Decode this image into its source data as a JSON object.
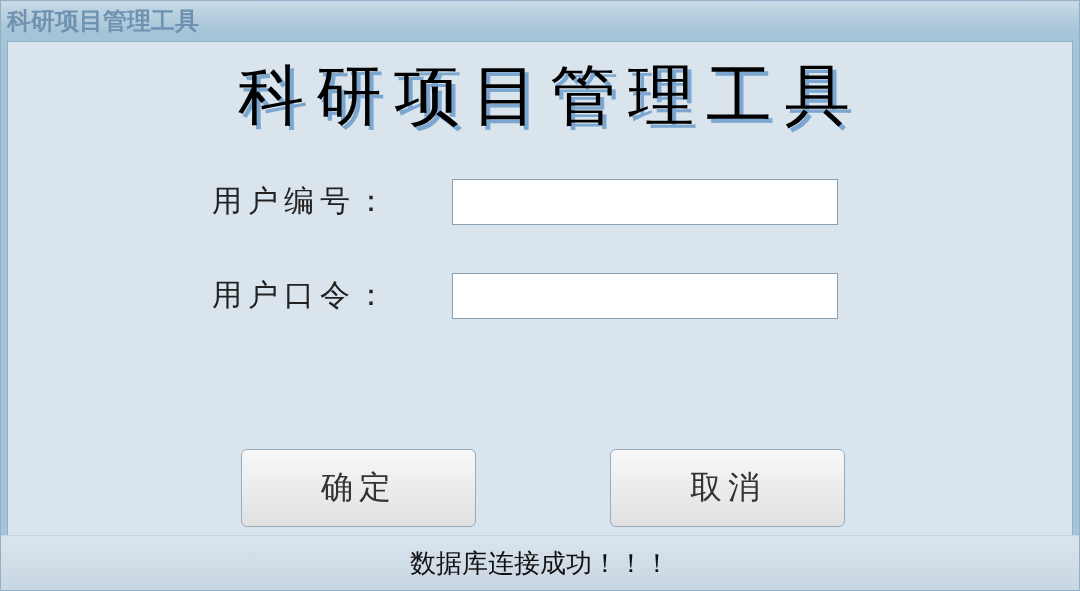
{
  "window": {
    "title": "科研项目管理工具"
  },
  "heading": "科研项目管理工具",
  "fields": [
    {
      "label": "用户编号："
    },
    {
      "label": "用户口令："
    }
  ],
  "buttons": [
    "确定",
    "取消"
  ],
  "status_bar": "数据库连接成功！！！"
}
